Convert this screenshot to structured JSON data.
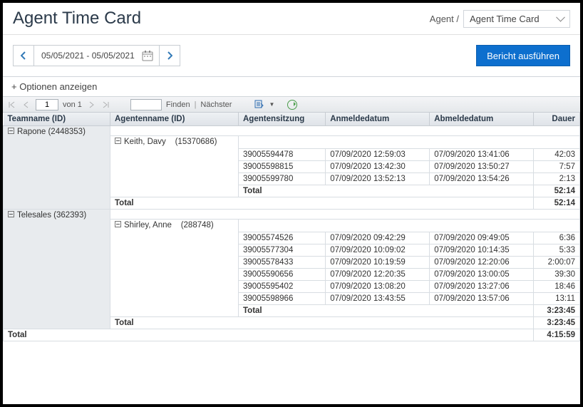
{
  "header": {
    "title": "Agent Time Card",
    "crumb_label": "Agent /",
    "crumb_select": "Agent Time Card"
  },
  "toolbar": {
    "date_range": "05/05/2021 - 05/05/2021",
    "run_label": "Bericht ausführen"
  },
  "options": {
    "toggle_label": "+  Optionen anzeigen"
  },
  "report_toolbar": {
    "page_input": "1",
    "of_label": "von 1",
    "find_label": "Finden",
    "next_label": "Nächster"
  },
  "columns": {
    "team": "Teamname (ID)",
    "agent": "Agentenname (ID)",
    "session": "Agentensitzung",
    "login": "Anmeldedatum",
    "logout": "Abmeldedatum",
    "duration": "Dauer"
  },
  "labels": {
    "total": "Total",
    "grand_total": "Total"
  },
  "teams": [
    {
      "name": "Rapone (2448353)",
      "agents": [
        {
          "name": "Keith, Davy",
          "id": "(15370686)",
          "sessions": [
            {
              "session": "39005594478",
              "login": "07/09/2020 12:59:03",
              "logout": "07/09/2020 13:41:06",
              "duration": "42:03"
            },
            {
              "session": "39005598815",
              "login": "07/09/2020 13:42:30",
              "logout": "07/09/2020 13:50:27",
              "duration": "7:57"
            },
            {
              "session": "39005599780",
              "login": "07/09/2020 13:52:13",
              "logout": "07/09/2020 13:54:26",
              "duration": "2:13"
            }
          ],
          "agent_total": "52:14"
        }
      ],
      "team_total": "52:14"
    },
    {
      "name": "Telesales (362393)",
      "agents": [
        {
          "name": "Shirley, Anne",
          "id": "(288748)",
          "sessions": [
            {
              "session": "39005574526",
              "login": "07/09/2020 09:42:29",
              "logout": "07/09/2020 09:49:05",
              "duration": "6:36"
            },
            {
              "session": "39005577304",
              "login": "07/09/2020 10:09:02",
              "logout": "07/09/2020 10:14:35",
              "duration": "5:33"
            },
            {
              "session": "39005578433",
              "login": "07/09/2020 10:19:59",
              "logout": "07/09/2020 12:20:06",
              "duration": "2:00:07"
            },
            {
              "session": "39005590656",
              "login": "07/09/2020 12:20:35",
              "logout": "07/09/2020 13:00:05",
              "duration": "39:30"
            },
            {
              "session": "39005595402",
              "login": "07/09/2020 13:08:20",
              "logout": "07/09/2020 13:27:06",
              "duration": "18:46"
            },
            {
              "session": "39005598966",
              "login": "07/09/2020 13:43:55",
              "logout": "07/09/2020 13:57:06",
              "duration": "13:11"
            }
          ],
          "agent_total": "3:23:45"
        }
      ],
      "team_total": "3:23:45"
    }
  ],
  "grand_total": "4:15:59"
}
